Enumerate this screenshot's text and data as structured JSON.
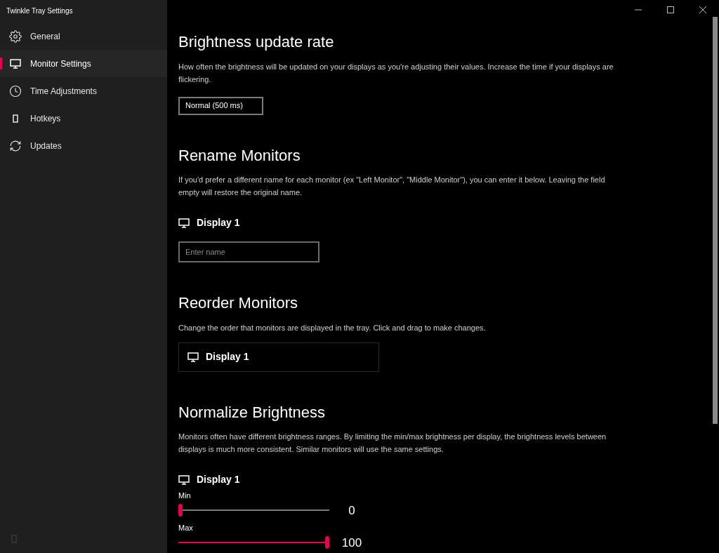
{
  "window": {
    "title": "Twinkle Tray Settings"
  },
  "sidebar": {
    "items": [
      {
        "label": "General",
        "kind": "gear",
        "selected": false
      },
      {
        "label": "Monitor Settings",
        "kind": "monitor",
        "selected": true
      },
      {
        "label": "Time Adjustments",
        "kind": "clock",
        "selected": false
      },
      {
        "label": "Hotkeys",
        "kind": "rectangle",
        "selected": false
      },
      {
        "label": "Updates",
        "kind": "refresh",
        "selected": false
      }
    ]
  },
  "sections": [
    {
      "kind": "dropdown",
      "title": "Brightness update rate",
      "description": "How often the brightness will be updated on your displays as you're adjusting their values. Increase the time if your displays are flickering.",
      "value": "Normal (500 ms)"
    },
    {
      "kind": "rename",
      "title": "Rename Monitors",
      "description": "If you'd prefer a different name for each monitor (ex \"Left Monitor\", \"Middle Monitor\"), you can enter it below. Leaving the field empty will restore the original name.",
      "monitors": [
        {
          "name": "Display 1",
          "placeholder": "Enter name"
        }
      ]
    },
    {
      "kind": "reorder",
      "title": "Reorder Monitors",
      "description": "Change the order that monitors are displayed in the tray. Click and drag to make changes.",
      "monitors": [
        {
          "name": "Display 1"
        }
      ]
    },
    {
      "kind": "normalize",
      "title": "Normalize Brightness",
      "description": "Monitors often have different brightness ranges. By limiting the min/max brightness per display, the brightness levels between displays is much more consistent. Similar monitors will use the same settings.",
      "monitors": [
        {
          "name": "Display 1",
          "sliders": [
            {
              "label": "Min",
              "level": 0,
              "reading": "0"
            },
            {
              "label": "Max",
              "level": 1,
              "reading": "100"
            }
          ]
        }
      ]
    }
  ]
}
